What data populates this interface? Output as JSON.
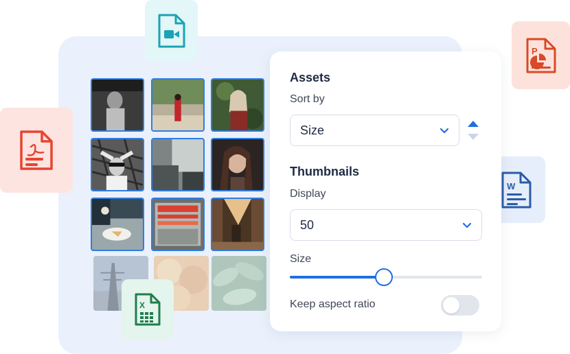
{
  "colors": {
    "accent": "#1f6fe0",
    "thumb_border": "#2f7de1",
    "panel_bg": "#eaf1fc",
    "video": "#1aa3b5",
    "pdf": "#e8442e",
    "ppt": "#d94a26",
    "word": "#2a5ca8",
    "excel": "#1f7d4d"
  },
  "badges": {
    "video": {
      "icon": "video-file-icon"
    },
    "pdf": {
      "icon": "pdf-file-icon"
    },
    "ppt": {
      "icon": "powerpoint-file-icon",
      "letter": "P"
    },
    "word": {
      "icon": "word-file-icon",
      "letter": "W"
    },
    "excel": {
      "icon": "excel-file-icon",
      "letter": "X"
    }
  },
  "assets": {
    "title": "Assets",
    "sort_by_label": "Sort by",
    "sort_by_value": "Size"
  },
  "thumbnails": {
    "title": "Thumbnails",
    "display_label": "Display",
    "display_value": "50",
    "size_label": "Size",
    "size_value": 0.49,
    "keep_aspect_label": "Keep aspect ratio",
    "keep_aspect_enabled": false
  }
}
